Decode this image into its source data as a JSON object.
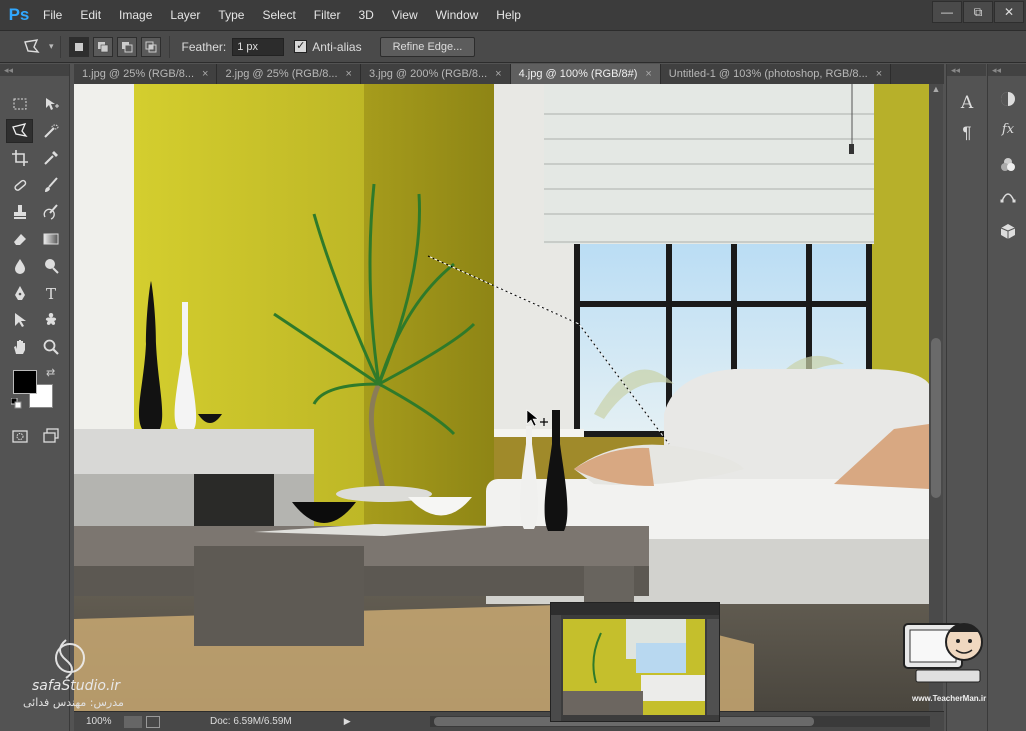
{
  "app": {
    "logo": "Ps"
  },
  "menu": [
    "File",
    "Edit",
    "Image",
    "Layer",
    "Type",
    "Select",
    "Filter",
    "3D",
    "View",
    "Window",
    "Help"
  ],
  "window_controls": {
    "minimize": "—",
    "restore": "⧉",
    "close": "✕"
  },
  "options": {
    "feather_label": "Feather:",
    "feather_value": "1 px",
    "antialias_label": "Anti-alias",
    "antialias_checked": true,
    "refine_edge_label": "Refine Edge..."
  },
  "tabs": [
    {
      "label": "1.jpg @ 25% (RGB/8...",
      "active": false
    },
    {
      "label": "2.jpg @ 25% (RGB/8...",
      "active": false
    },
    {
      "label": "3.jpg @ 200% (RGB/8...",
      "active": false
    },
    {
      "label": "4.jpg @ 100% (RGB/8#)",
      "active": true
    },
    {
      "label": "Untitled-1 @ 103% (photoshop, RGB/8...",
      "active": false
    }
  ],
  "tab_close": "×",
  "status": {
    "zoom": "100%",
    "doc": "Doc: 6.59M/6.59M",
    "arrow": "▶"
  },
  "colors": {
    "foreground": "#000000",
    "background": "#ffffff",
    "accent": "#31a8ff"
  },
  "watermark": {
    "site": "safaStudio.ir",
    "teacher": "مدرس: مهندس فدائی",
    "right_url": "www.TeacherMan.ir"
  },
  "dock": {
    "char_label": "A",
    "para_label": "¶",
    "fx_label": "fx"
  }
}
